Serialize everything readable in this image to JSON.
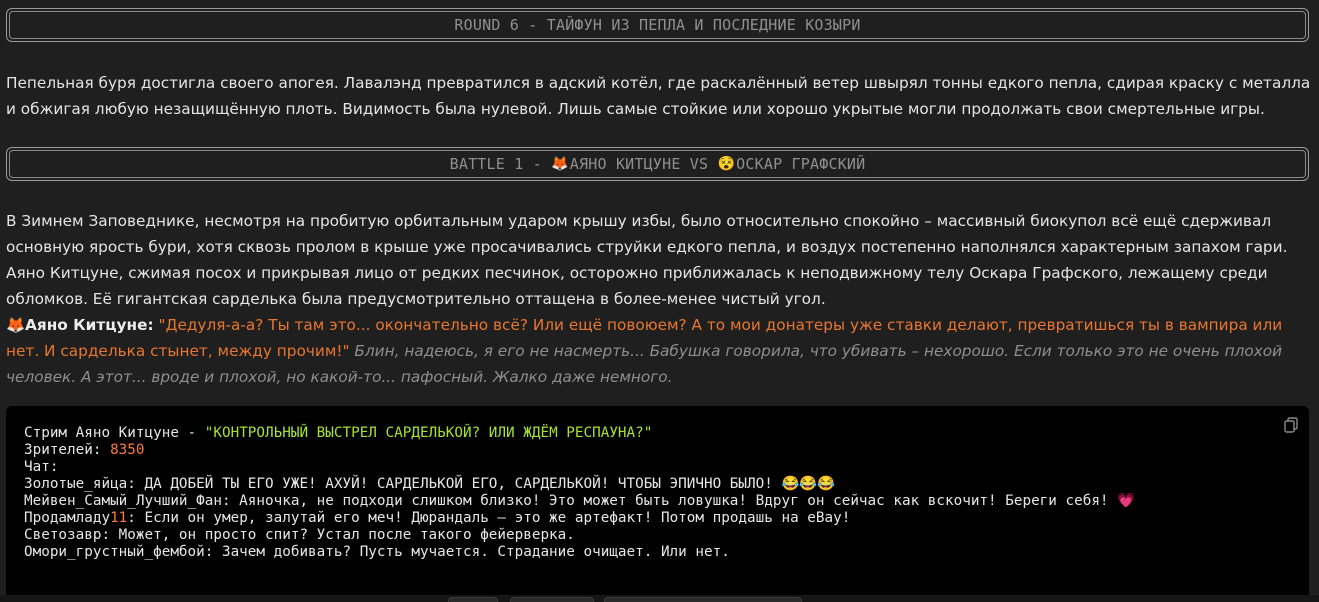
{
  "round_banner": "ROUND 6 - ТАЙФУН ИЗ ПЕПЛА И ПОСЛЕДНИЕ КОЗЫРИ",
  "intro_text": "Пепельная буря достигла своего апогея. Лавалэнд превратился в адский котёл, где раскалённый ветер швырял тонны едкого пепла, сдирая краску с металла и обжигая любую незащищённую плоть. Видимость была нулевой. Лишь самые стойкие или хорошо укрытые могли продолжать свои смертельные игры.",
  "battle_banner": {
    "prefix": "BATTLE 1 - ",
    "fighter1_emoji": "🦊",
    "fighter1": "АЯНО КИТЦУНЕ",
    "vs": " VS ",
    "fighter2_emoji": "😵",
    "fighter2": "ОСКАР ГРАФСКИЙ"
  },
  "scene_text": "В Зимнем Заповеднике, несмотря на пробитую орбитальным ударом крышу избы, было относительно спокойно – массивный биокупол всё ещё сдерживал основную ярость бури, хотя сквозь пролом в крыше уже просачивались струйки едкого пепла, и воздух постепенно наполнялся характерным запахом гари. Аяно Китцуне, сжимая посох и прикрывая лицо от редких песчинок, осторожно приближалась к неподвижному телу Оскара Графского, лежащему среди обломков. Её гигантская сарделька была предусмотрительно оттащена в более-менее чистый угол.",
  "dialogue": {
    "emoji": "🦊",
    "speaker": "Аяно Китцуне:",
    "speech": "\"Дедуля-а-а? Ты там это... окончательно всё? Или ещё повоюем? А то мои донатеры уже ставки делают, превратишься ты в вампира или нет. И сарделька стынет, между прочим!\"",
    "thought": "Блин, надеюсь, я его не насмерть... Бабушка говорила, что убивать – нехорошо. Если только это не очень плохой человек. А этот... вроде и плохой, но какой-то... пафосный. Жалко даже немного."
  },
  "stream": {
    "title_prefix": "Стрим Аяно Китцуне - ",
    "title": "\"КОНТРОЛЬНЫЙ ВЫСТРЕЛ САРДЕЛЬКОЙ? ИЛИ ЖДЁМ РЕСПАУНА?\"",
    "viewers_label": "Зрителей: ",
    "viewers": "8350",
    "chat_label": "Чат:",
    "messages": [
      {
        "prefix": "Золотые_яйца: ДА ДОБЕЙ ТЫ ЕГО УЖЕ! АХУЙ! САРДЕЛЬКОЙ ЕГО, САРДЕЛЬКОЙ! ЧТОБЫ ЭПИЧНО БЫЛО! 😂😂😂"
      },
      {
        "prefix": "Мейвен_Самый_Лучший_Фан: Аяночка, не подходи слишком близко! Это может быть ловушка! Вдруг он сейчас как вскочит! Береги себя! 💗"
      },
      {
        "user_a": "Продамладу",
        "user_num": "11",
        "rest": ": Если он умер, залутай его меч! Дюрандаль – это же артефакт! Потом продашь на eBay!"
      },
      {
        "prefix": "Светозавр: Может, он просто спит? Устал после такого фейерверка."
      },
      {
        "prefix": "Омори_грустный_фембой: Зачем добивать? Пусть мучается. Страдание очищает. Или нет."
      }
    ]
  },
  "copy_icon": "copy-icon",
  "colors": {
    "background": "#1f1f1f",
    "speech": "#e8762f",
    "thought": "#8e8e8e",
    "code_string": "#a6e22e",
    "code_number": "#fd7a3b"
  }
}
